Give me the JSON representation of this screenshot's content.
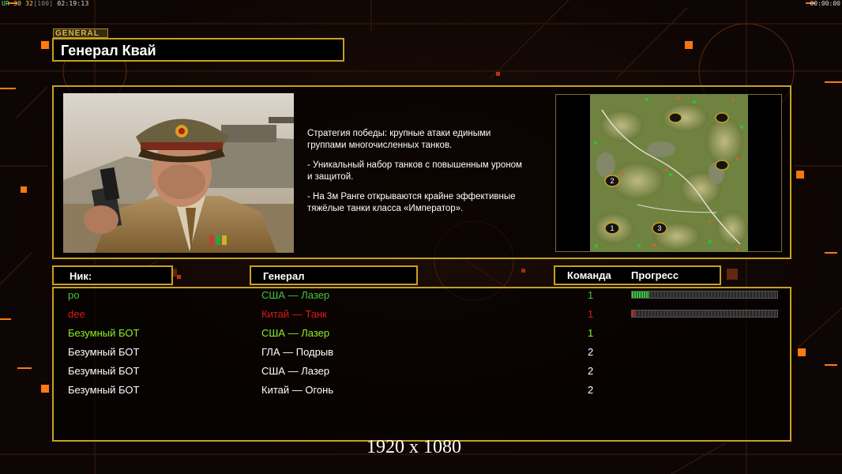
{
  "status_bar": {
    "left_tag": "UR",
    "fps": "30",
    "val2": "32",
    "bracket": "[100]",
    "time": "02:19:13",
    "right_time": "00:00:00"
  },
  "general": {
    "tag": "GENERAL",
    "name": "Генерал Квай",
    "description": [
      "Стратегия победы: крупные атаки едиными\n группами многочисленных танков.",
      "- Уникальный набор танков с повышенным уроном\n и защитой.",
      "- На 3м Ранге открываются крайне эффективные\n тяжёлые танки класса «Император»."
    ]
  },
  "minimap": {
    "start_positions": [
      "2",
      "1",
      "3"
    ]
  },
  "table": {
    "headers": {
      "nick": "Ник:",
      "general": "Генерал",
      "team": "Команда",
      "progress": "Прогресс"
    },
    "rows": [
      {
        "nick": "ро",
        "general": "США — Лазер",
        "team": "1",
        "color": "#3ec83e",
        "progress": 0.12,
        "progress_color": "#3ec83e"
      },
      {
        "nick": "dee",
        "general": "Китай — Танк",
        "team": "1",
        "color": "#e01818",
        "progress": 0.02,
        "progress_color": "#e01818"
      },
      {
        "nick": "Безумный БОТ",
        "general": "США — Лазер",
        "team": "1",
        "color": "#8ef024"
      },
      {
        "nick": "Безумный БОТ",
        "general": "ГЛА — Подрыв",
        "team": "2",
        "color": "#ffffff"
      },
      {
        "nick": "Безумный БОТ",
        "general": "США — Лазер",
        "team": "2",
        "color": "#ffffff"
      },
      {
        "nick": "Безумный БОТ",
        "general": "Китай — Огонь",
        "team": "2",
        "color": "#ffffff"
      }
    ]
  },
  "resolution_label": "1920 x 1080",
  "colors": {
    "frame": "#c8a020",
    "accent_orange": "#ff7a10",
    "background": "#0e0604"
  }
}
